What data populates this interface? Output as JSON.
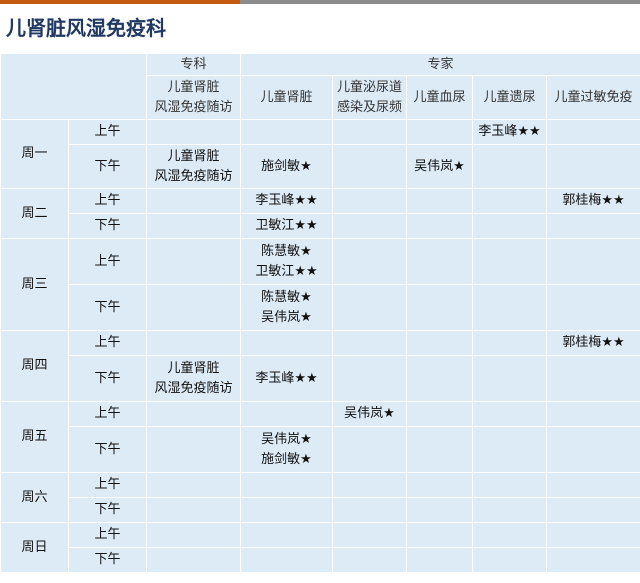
{
  "header": {
    "title": "儿肾脏风湿免疫科"
  },
  "columns": {
    "group_specialty": "专科",
    "group_expert": "专家",
    "specialty": "儿童肾脏\n风湿免疫随访",
    "expert": [
      "儿童肾脏",
      "儿童泌尿道\n感染及尿频",
      "儿童血尿",
      "儿童遗尿",
      "儿童过敏免疫"
    ]
  },
  "periods": {
    "am": "上午",
    "pm": "下午"
  },
  "days": [
    {
      "name": "周一",
      "am": {
        "specialty": "",
        "kidney": "",
        "uti": "",
        "hematuria": "",
        "enuresis": "李玉峰★★",
        "allergy": ""
      },
      "pm": {
        "specialty": "儿童肾脏\n风湿免疫随访",
        "kidney": "施剑敏★",
        "uti": "",
        "hematuria": "吴伟岚★",
        "enuresis": "",
        "allergy": ""
      }
    },
    {
      "name": "周二",
      "am": {
        "specialty": "",
        "kidney": "李玉峰★★",
        "uti": "",
        "hematuria": "",
        "enuresis": "",
        "allergy": "郭桂梅★★"
      },
      "pm": {
        "specialty": "",
        "kidney": "卫敏江★★",
        "uti": "",
        "hematuria": "",
        "enuresis": "",
        "allergy": ""
      }
    },
    {
      "name": "周三",
      "am": {
        "specialty": "",
        "kidney": "陈慧敏★\n卫敏江★★",
        "uti": "",
        "hematuria": "",
        "enuresis": "",
        "allergy": ""
      },
      "pm": {
        "specialty": "",
        "kidney": "陈慧敏★\n吴伟岚★",
        "uti": "",
        "hematuria": "",
        "enuresis": "",
        "allergy": ""
      }
    },
    {
      "name": "周四",
      "am": {
        "specialty": "",
        "kidney": "",
        "uti": "",
        "hematuria": "",
        "enuresis": "",
        "allergy": "郭桂梅★★"
      },
      "pm": {
        "specialty": "儿童肾脏\n风湿免疫随访",
        "kidney": "李玉峰★★",
        "uti": "",
        "hematuria": "",
        "enuresis": "",
        "allergy": ""
      }
    },
    {
      "name": "周五",
      "am": {
        "specialty": "",
        "kidney": "",
        "uti": "吴伟岚★",
        "hematuria": "",
        "enuresis": "",
        "allergy": ""
      },
      "pm": {
        "specialty": "",
        "kidney": "吴伟岚★\n施剑敏★",
        "uti": "",
        "hematuria": "",
        "enuresis": "",
        "allergy": ""
      }
    },
    {
      "name": "周六",
      "am": {
        "specialty": "",
        "kidney": "",
        "uti": "",
        "hematuria": "",
        "enuresis": "",
        "allergy": ""
      },
      "pm": {
        "specialty": "",
        "kidney": "",
        "uti": "",
        "hematuria": "",
        "enuresis": "",
        "allergy": ""
      }
    },
    {
      "name": "周日",
      "am": {
        "specialty": "",
        "kidney": "",
        "uti": "",
        "hematuria": "",
        "enuresis": "",
        "allergy": ""
      },
      "pm": {
        "specialty": "",
        "kidney": "",
        "uti": "",
        "hematuria": "",
        "enuresis": "",
        "allergy": ""
      }
    }
  ],
  "colors": {
    "title": "#1f3864",
    "cell_bg": "#ddebf7",
    "accent_bar": "#c55a11",
    "top_bar": "#8c8c8c"
  }
}
